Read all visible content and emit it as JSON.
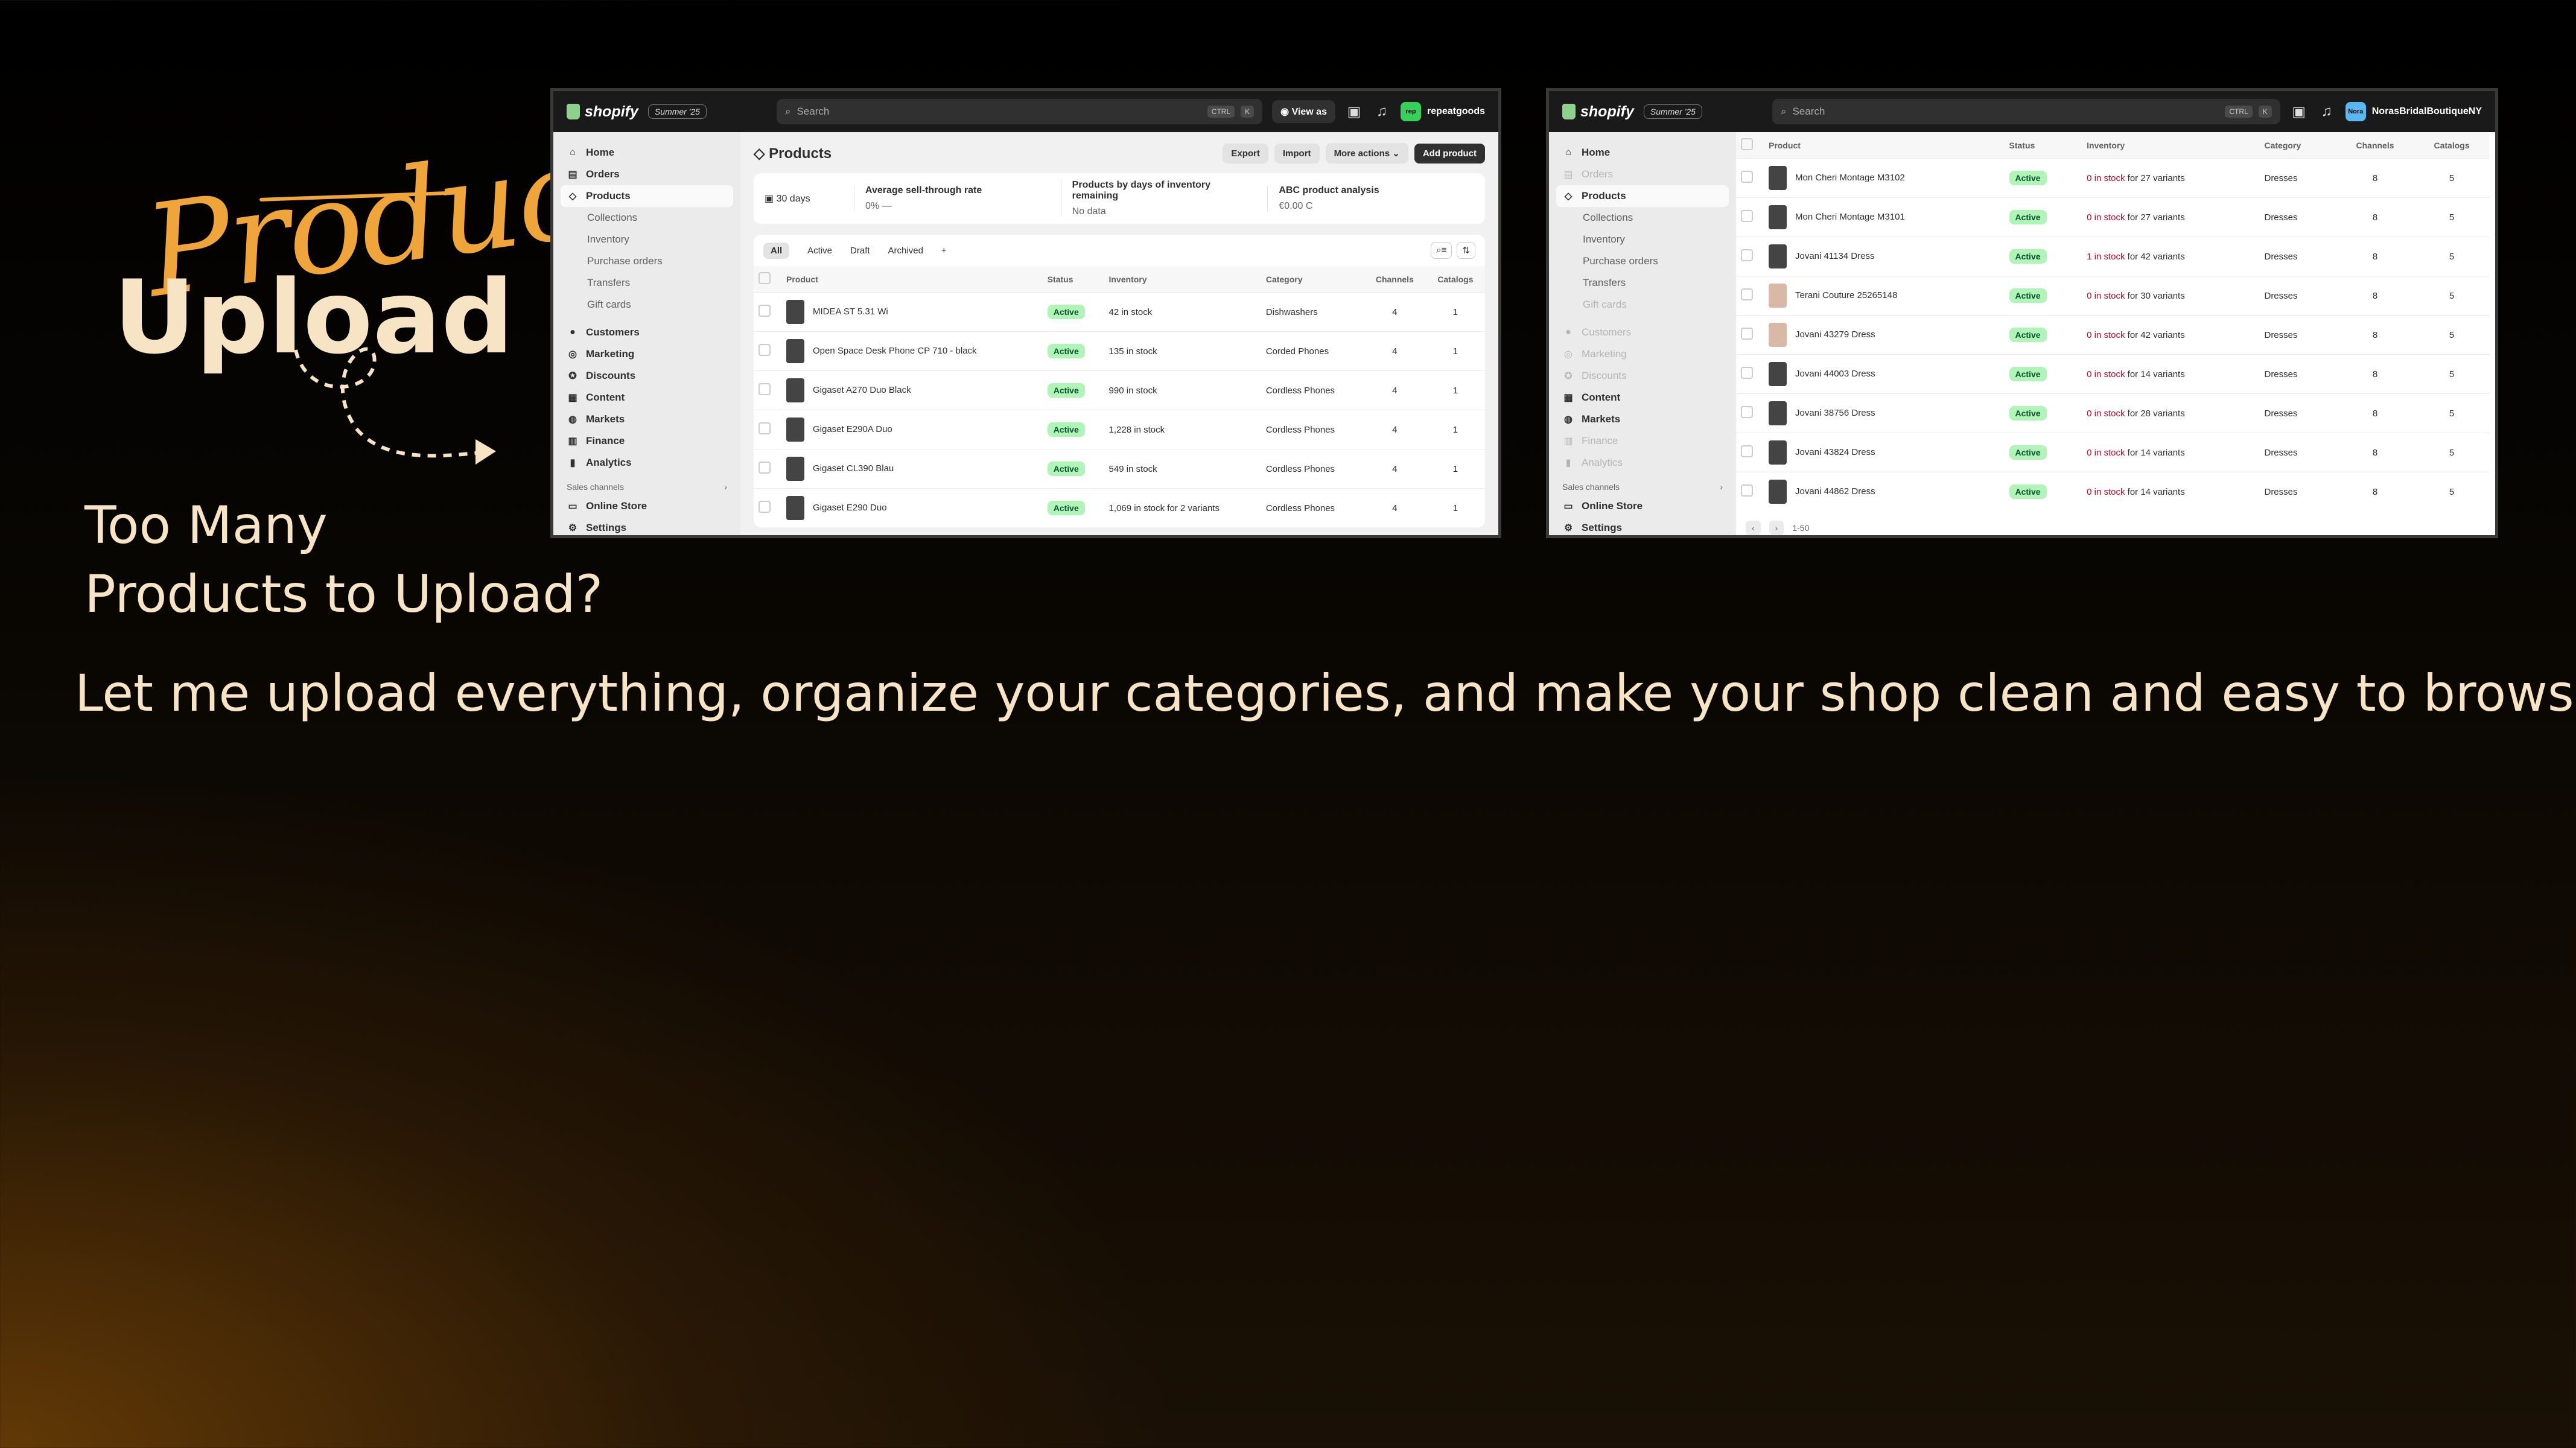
{
  "promo": {
    "script_title": "Product",
    "big_title": "Upload",
    "question_line1": "Too Many",
    "question_line2": "Products to Upload?",
    "tagline": "Let me upload everything, organize your categories, and make your shop clean and easy to browse.",
    "accent_color": "#f0a53a",
    "text_color": "#f7e4c4"
  },
  "shot1": {
    "logo": "shopify",
    "edition": "Summer '25",
    "search_placeholder": "Search",
    "kbd1": "CTRL",
    "kbd2": "K",
    "view_as": "View as",
    "store_name": "repeatgoods",
    "store_badge": "rep",
    "nav": [
      "Home",
      "Orders",
      "Products"
    ],
    "product_sub": [
      "Collections",
      "Inventory",
      "Purchase orders",
      "Transfers",
      "Gift cards"
    ],
    "nav2": [
      "Customers",
      "Marketing",
      "Discounts",
      "Content",
      "Markets",
      "Finance",
      "Analytics"
    ],
    "sales_channels": "Sales channels",
    "online_store": "Online Store",
    "settings": "Settings",
    "page_title": "Products",
    "btn_export": "Export",
    "btn_import": "Import",
    "btn_more": "More actions",
    "btn_add": "Add product",
    "stat_period": "30 days",
    "stat1_title": "Average sell-through rate",
    "stat1_value": "0% —",
    "stat2_title": "Products by days of inventory remaining",
    "stat2_value": "No data",
    "stat3_title": "ABC product analysis",
    "stat3_value": "€0.00 C",
    "tabs": [
      "All",
      "Active",
      "Draft",
      "Archived"
    ],
    "columns": [
      "Product",
      "Status",
      "Inventory",
      "Category",
      "Channels",
      "Catalogs"
    ],
    "rows": [
      {
        "product": "MIDEA ST 5.31 Wi",
        "status": "Active",
        "inventory": "42 in stock",
        "category": "Dishwashers",
        "channels": "4",
        "catalogs": "1"
      },
      {
        "product": "Open Space Desk Phone CP 710 - black",
        "status": "Active",
        "inventory": "135 in stock",
        "category": "Corded Phones",
        "channels": "4",
        "catalogs": "1"
      },
      {
        "product": "Gigaset A270 Duo Black",
        "status": "Active",
        "inventory": "990 in stock",
        "category": "Cordless Phones",
        "channels": "4",
        "catalogs": "1"
      },
      {
        "product": "Gigaset E290A Duo",
        "status": "Active",
        "inventory": "1,228 in stock",
        "category": "Cordless Phones",
        "channels": "4",
        "catalogs": "1"
      },
      {
        "product": "Gigaset CL390 Blau",
        "status": "Active",
        "inventory": "549 in stock",
        "category": "Cordless Phones",
        "channels": "4",
        "catalogs": "1"
      },
      {
        "product": "Gigaset E290 Duo",
        "status": "Active",
        "inventory": "1,069 in stock for 2 variants",
        "category": "Cordless Phones",
        "channels": "4",
        "catalogs": "1"
      }
    ]
  },
  "shot2": {
    "logo": "shopify",
    "edition": "Summer '25",
    "search_placeholder": "Search",
    "kbd1": "CTRL",
    "kbd2": "K",
    "store_name": "NorasBridalBoutiqueNY",
    "store_badge": "Nora",
    "nav": [
      "Home",
      "Orders",
      "Products"
    ],
    "product_sub": [
      "Collections",
      "Inventory",
      "Purchase orders",
      "Transfers",
      "Gift cards"
    ],
    "nav2": [
      "Customers",
      "Marketing",
      "Discounts",
      "Content",
      "Markets",
      "Finance",
      "Analytics"
    ],
    "sales_channels": "Sales channels",
    "online_store": "Online Store",
    "settings": "Settings",
    "columns": [
      "Product",
      "Status",
      "Inventory",
      "Category",
      "Channels",
      "Catalogs"
    ],
    "rows": [
      {
        "product": "Mon Cheri Montage M3102",
        "status": "Active",
        "stock": "0 in stock",
        "rest": " for 27 variants",
        "category": "Dresses",
        "channels": "8",
        "catalogs": "5"
      },
      {
        "product": "Mon Cheri Montage M3101",
        "status": "Active",
        "stock": "0 in stock",
        "rest": " for 27 variants",
        "category": "Dresses",
        "channels": "8",
        "catalogs": "5"
      },
      {
        "product": "Jovani 41134 Dress",
        "status": "Active",
        "stock": "1 in stock",
        "rest": " for 42 variants",
        "category": "Dresses",
        "channels": "8",
        "catalogs": "5"
      },
      {
        "product": "Terani Couture 25265148",
        "status": "Active",
        "stock": "0 in stock",
        "rest": " for 30 variants",
        "category": "Dresses",
        "channels": "8",
        "catalogs": "5"
      },
      {
        "product": "Jovani 43279 Dress",
        "status": "Active",
        "stock": "0 in stock",
        "rest": " for 42 variants",
        "category": "Dresses",
        "channels": "8",
        "catalogs": "5"
      },
      {
        "product": "Jovani 44003 Dress",
        "status": "Active",
        "stock": "0 in stock",
        "rest": " for 14 variants",
        "category": "Dresses",
        "channels": "8",
        "catalogs": "5"
      },
      {
        "product": "Jovani 38756 Dress",
        "status": "Active",
        "stock": "0 in stock",
        "rest": " for 28 variants",
        "category": "Dresses",
        "channels": "8",
        "catalogs": "5"
      },
      {
        "product": "Jovani 43824 Dress",
        "status": "Active",
        "stock": "0 in stock",
        "rest": " for 14 variants",
        "category": "Dresses",
        "channels": "8",
        "catalogs": "5"
      },
      {
        "product": "Jovani 44862 Dress",
        "status": "Active",
        "stock": "0 in stock",
        "rest": " for 14 variants",
        "category": "Dresses",
        "channels": "8",
        "catalogs": "5"
      }
    ],
    "pager": "1-50"
  }
}
